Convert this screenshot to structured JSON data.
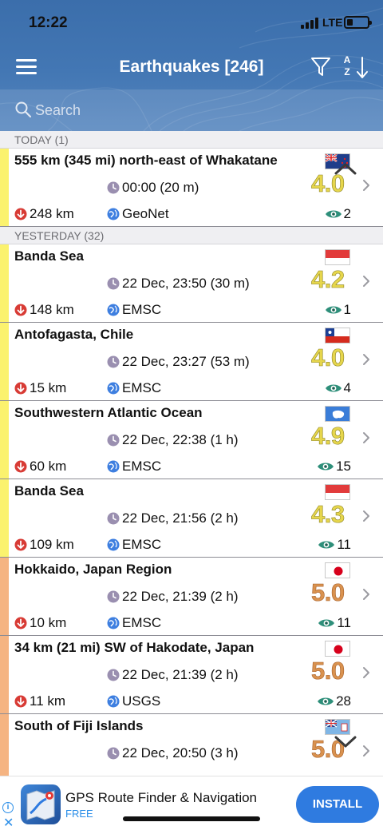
{
  "status_bar": {
    "time": "12:22",
    "network": "LTE",
    "battery_level": 0.3
  },
  "nav": {
    "title": "Earthquakes [246]"
  },
  "sort": {
    "a": "A",
    "z": "Z"
  },
  "search": {
    "placeholder": "Search"
  },
  "colors": {
    "header": "#3b6eab",
    "mag_yellow": "#e6d64c",
    "mag_orange": "#d9924f",
    "strip_yellow": "#fbf26e",
    "strip_orange": "#f5b482",
    "accent_blue": "#2f7be0"
  },
  "sections": [
    {
      "header": "TODAY (1)",
      "rows": [
        {
          "place": "555 km (345 mi) north-east of Whakatane",
          "flag": "nz",
          "time": "00:00 (20 m)",
          "mag": "4.0",
          "level": "yellow",
          "depth": "248 km",
          "source": "GeoNet",
          "views": "2"
        }
      ]
    },
    {
      "header": "YESTERDAY (32)",
      "rows": [
        {
          "place": "Banda Sea",
          "flag": "id",
          "time": "22 Dec, 23:50 (30 m)",
          "mag": "4.2",
          "level": "yellow",
          "depth": "148 km",
          "source": "EMSC",
          "views": "1"
        },
        {
          "place": "Antofagasta, Chile",
          "flag": "cl",
          "time": "22 Dec, 23:27 (53 m)",
          "mag": "4.0",
          "level": "yellow",
          "depth": "15 km",
          "source": "EMSC",
          "views": "4"
        },
        {
          "place": "Southwestern Atlantic Ocean",
          "flag": "aq",
          "time": "22 Dec, 22:38 (1 h)",
          "mag": "4.9",
          "level": "yellow",
          "depth": "60 km",
          "source": "EMSC",
          "views": "15"
        },
        {
          "place": "Banda Sea",
          "flag": "id",
          "time": "22 Dec, 21:56 (2 h)",
          "mag": "4.3",
          "level": "yellow",
          "depth": "109 km",
          "source": "EMSC",
          "views": "11"
        },
        {
          "place": "Hokkaido, Japan Region",
          "flag": "jp",
          "time": "22 Dec, 21:39 (2 h)",
          "mag": "5.0",
          "level": "orange",
          "depth": "10 km",
          "source": "EMSC",
          "views": "11"
        },
        {
          "place": "34 km (21 mi) SW of Hakodate, Japan",
          "flag": "jp",
          "time": "22 Dec, 21:39 (2 h)",
          "mag": "5.0",
          "level": "orange",
          "depth": "11 km",
          "source": "USGS",
          "views": "28"
        },
        {
          "place": "South of Fiji Islands",
          "flag": "fj",
          "time": "22 Dec, 20:50 (3 h)",
          "mag": "5.0",
          "level": "orange",
          "depth": "",
          "source": "",
          "views": ""
        }
      ]
    }
  ],
  "ad": {
    "title": "GPS Route Finder & Navigation",
    "subtitle": "FREE",
    "install_label": "INSTALL",
    "info_glyph": "i",
    "close_glyph": "✕"
  }
}
